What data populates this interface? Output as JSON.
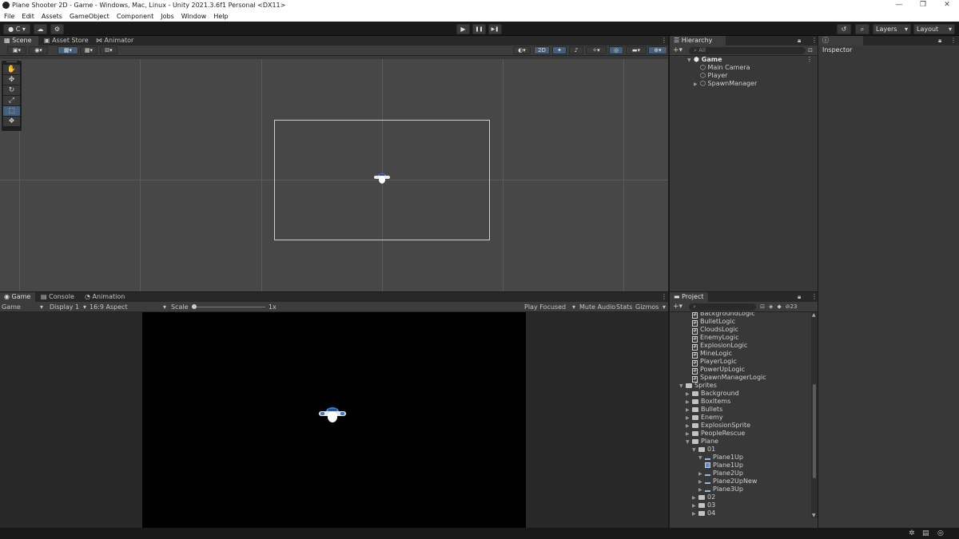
{
  "window": {
    "title": "Plane Shooter 2D - Game - Windows, Mac, Linux - Unity 2021.3.6f1 Personal <DX11>",
    "min": "—",
    "max": "❐",
    "close": "✕"
  },
  "menu": [
    "File",
    "Edit",
    "Assets",
    "GameObject",
    "Component",
    "Jobs",
    "Window",
    "Help"
  ],
  "toolbar": {
    "account": "C",
    "layers": "Layers",
    "layout": "Layout",
    "play": "▶",
    "pause": "❚❚",
    "step": "▶❚"
  },
  "scene_panel": {
    "tabs": [
      "Scene",
      "Asset Store",
      "Animator"
    ],
    "mode_2d": "2D"
  },
  "hierarchy": {
    "tab": "Hierarchy",
    "search_placeholder": "All",
    "root": "Game",
    "children": [
      "Main Camera",
      "Player",
      "SpawnManager"
    ]
  },
  "inspector": {
    "tab": "Inspector"
  },
  "game_panel": {
    "tabs": [
      "Game",
      "Console",
      "Animation"
    ],
    "mode": "Game",
    "display": "Display 1",
    "aspect": "16:9 Aspect",
    "scale_label": "Scale",
    "scale_value": "1x",
    "scale_level": 0.0,
    "play_focused": "Play Focused",
    "mute": "Mute Audio",
    "stats": "Stats",
    "gizmos": "Gizmos"
  },
  "project": {
    "tab": "Project",
    "count": "23",
    "items": [
      {
        "label": "BackgroundLogic",
        "kind": "script",
        "indent": 0
      },
      {
        "label": "BulletLogic",
        "kind": "script",
        "indent": 0
      },
      {
        "label": "CloudsLogic",
        "kind": "script",
        "indent": 0
      },
      {
        "label": "EnemyLogic",
        "kind": "script",
        "indent": 0
      },
      {
        "label": "ExplosionLogic",
        "kind": "script",
        "indent": 0
      },
      {
        "label": "MineLogic",
        "kind": "script",
        "indent": 0
      },
      {
        "label": "PlayerLogic",
        "kind": "script",
        "indent": 0
      },
      {
        "label": "PowerUpLogic",
        "kind": "script",
        "indent": 0
      },
      {
        "label": "SpawnManagerLogic",
        "kind": "script",
        "indent": 0
      },
      {
        "label": "Sprites",
        "kind": "folder-open",
        "indent": -1
      },
      {
        "label": "Background",
        "kind": "folder",
        "indent": 0
      },
      {
        "label": "BoxItems",
        "kind": "folder",
        "indent": 0
      },
      {
        "label": "Bullets",
        "kind": "folder",
        "indent": 0
      },
      {
        "label": "Enemy",
        "kind": "folder",
        "indent": 0
      },
      {
        "label": "ExplosionSprite",
        "kind": "folder",
        "indent": 0
      },
      {
        "label": "PeopleRescue",
        "kind": "folder",
        "indent": 0
      },
      {
        "label": "Plane",
        "kind": "folder-open",
        "indent": 0
      },
      {
        "label": "01",
        "kind": "folder-open",
        "indent": 1
      },
      {
        "label": "Plane1Up",
        "kind": "sprite-open",
        "indent": 2
      },
      {
        "label": "Plane1Up",
        "kind": "sprite",
        "indent": 3
      },
      {
        "label": "Plane2Up",
        "kind": "sprite-closed",
        "indent": 2
      },
      {
        "label": "Plane2UpNew",
        "kind": "sprite-closed",
        "indent": 2
      },
      {
        "label": "Plane3Up",
        "kind": "sprite-closed",
        "indent": 2
      },
      {
        "label": "02",
        "kind": "folder",
        "indent": 1
      },
      {
        "label": "03",
        "kind": "folder",
        "indent": 1
      },
      {
        "label": "04",
        "kind": "folder",
        "indent": 1
      }
    ]
  },
  "colors": {
    "accent": "#46607c",
    "panel": "#383838",
    "scene_bg": "#474747"
  }
}
